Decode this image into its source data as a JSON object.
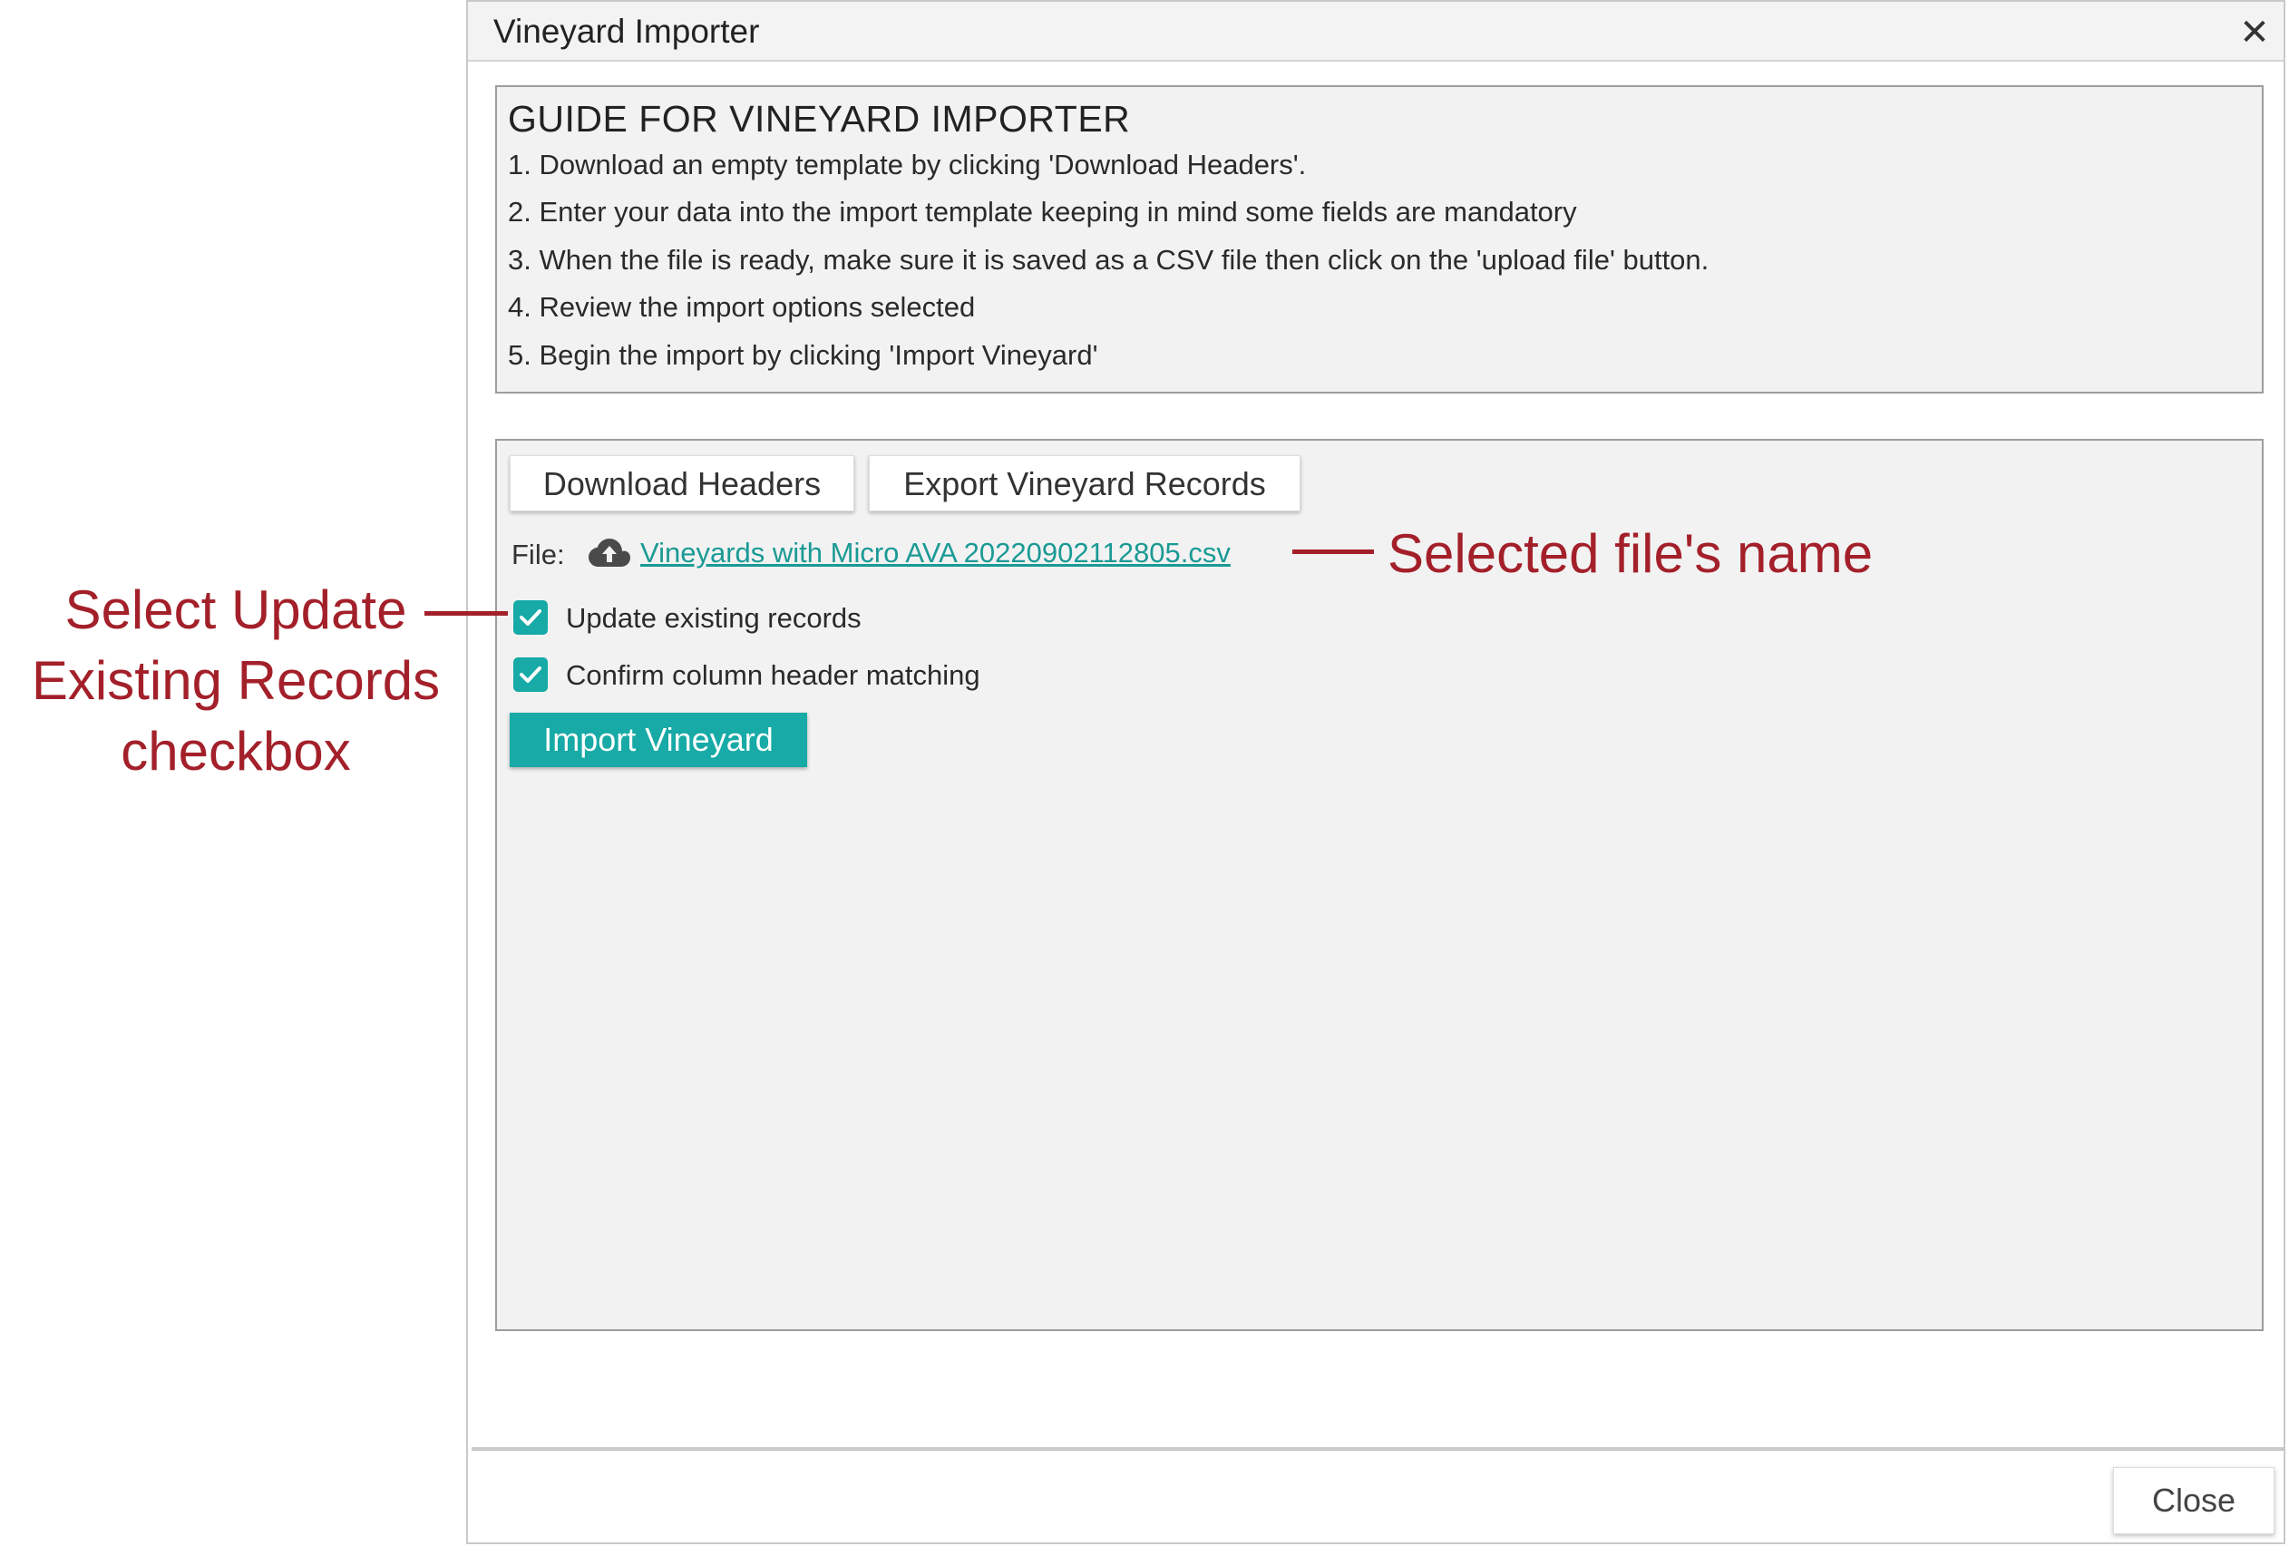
{
  "dialog": {
    "title": "Vineyard Importer",
    "close_icon": "close-icon"
  },
  "guide": {
    "title": "GUIDE FOR VINEYARD IMPORTER",
    "steps": [
      "1. Download an empty template by clicking 'Download Headers'.",
      "2. Enter your data into the import template keeping in mind some fields are mandatory",
      "3. When the file is ready, make sure it is saved as a CSV file then click on the 'upload file' button.",
      "4. Review the import options selected",
      "5. Begin the import by clicking 'Import Vineyard'"
    ]
  },
  "toolbar": {
    "download_headers_label": "Download Headers",
    "export_records_label": "Export Vineyard Records"
  },
  "file": {
    "label": "File:",
    "icon": "cloud-upload-icon",
    "name": "Vineyards with Micro AVA 20220902112805.csv"
  },
  "options": {
    "update_existing": {
      "label": "Update existing records",
      "checked": true
    },
    "confirm_header": {
      "label": "Confirm column header matching",
      "checked": true
    }
  },
  "actions": {
    "import_label": "Import Vineyard",
    "close_label": "Close"
  },
  "annotations": {
    "left_lines": [
      "Select Update",
      "Existing Records",
      "checkbox"
    ],
    "right": "Selected file's name",
    "color": "#a3202a"
  },
  "colors": {
    "accent": "#17aaa6",
    "link": "#1a9a95",
    "panel_bg": "#f2f2f2"
  }
}
